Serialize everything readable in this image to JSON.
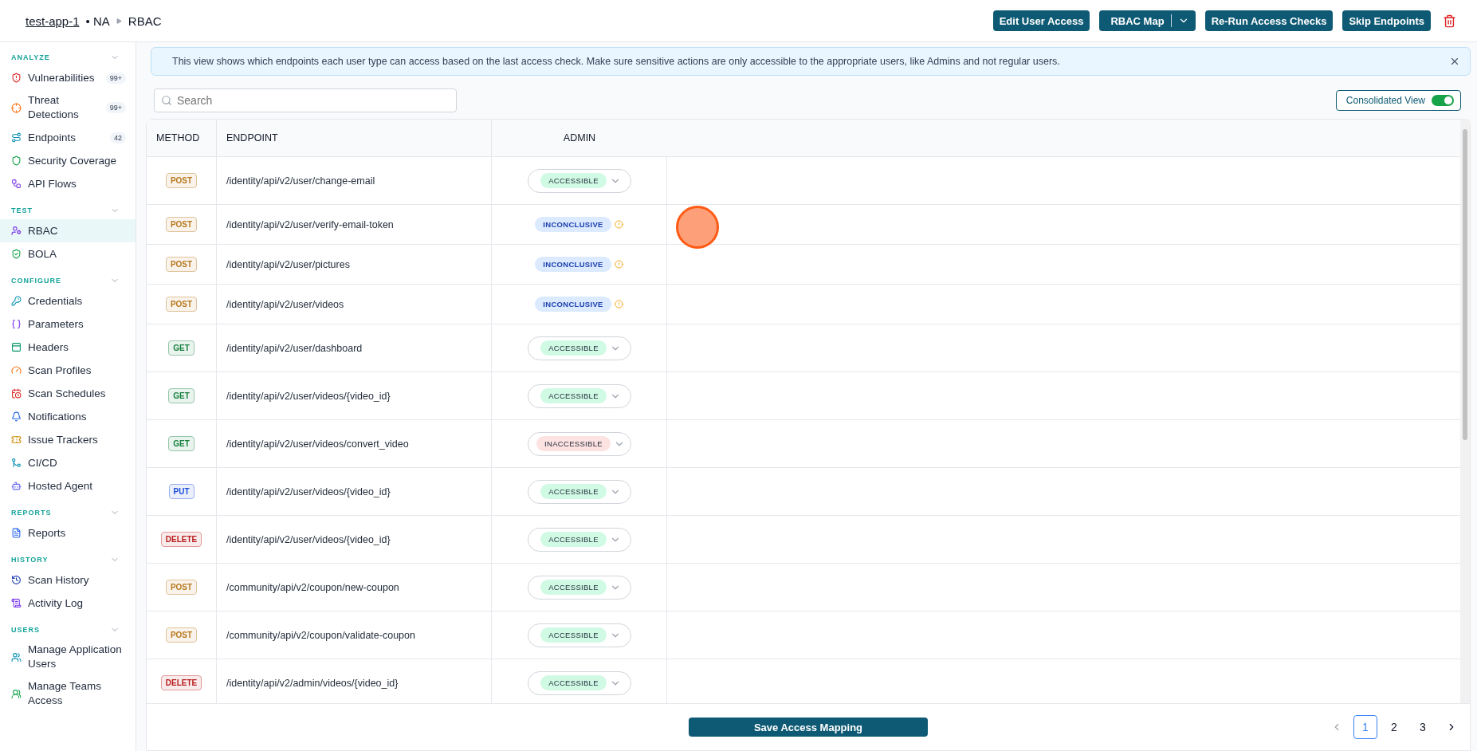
{
  "breadcrumb": {
    "app": "test-app-1",
    "env": "• NA",
    "page": "RBAC"
  },
  "actions": [
    {
      "label": "Edit User Access",
      "kind": "plain"
    },
    {
      "label": "RBAC Map",
      "kind": "split"
    },
    {
      "label": "Re-Run Access Checks",
      "kind": "plain"
    },
    {
      "label": "Skip Endpoints",
      "kind": "plain"
    }
  ],
  "sidebar": [
    {
      "title": "ANALYZE",
      "expanded": true,
      "items": [
        {
          "label": "Vulnerabilities",
          "badge": "99+",
          "selected": false
        },
        {
          "label": "Threat Detections",
          "badge": "99+",
          "selected": false
        },
        {
          "label": "Endpoints",
          "badge": "42",
          "selected": false
        },
        {
          "label": "Security Coverage",
          "selected": false
        },
        {
          "label": "API Flows",
          "selected": false
        }
      ]
    },
    {
      "title": "TEST",
      "expanded": true,
      "items": [
        {
          "label": "RBAC",
          "selected": true
        },
        {
          "label": "BOLA",
          "selected": false
        }
      ]
    },
    {
      "title": "CONFIGURE",
      "expanded": true,
      "items": [
        {
          "label": "Credentials",
          "selected": false
        },
        {
          "label": "Parameters",
          "selected": false
        },
        {
          "label": "Headers",
          "selected": false
        },
        {
          "label": "Scan Profiles",
          "selected": false
        },
        {
          "label": "Scan Schedules",
          "selected": false
        },
        {
          "label": "Notifications",
          "selected": false
        },
        {
          "label": "Issue Trackers",
          "selected": false
        },
        {
          "label": "CI/CD",
          "selected": false
        },
        {
          "label": "Hosted Agent",
          "selected": false
        }
      ]
    },
    {
      "title": "REPORTS",
      "expanded": true,
      "items": [
        {
          "label": "Reports",
          "selected": false
        }
      ]
    },
    {
      "title": "HISTORY",
      "expanded": true,
      "items": [
        {
          "label": "Scan History",
          "selected": false
        },
        {
          "label": "Activity Log",
          "selected": false
        }
      ]
    },
    {
      "title": "USERS",
      "expanded": true,
      "items": [
        {
          "label": "Manage Application Users",
          "selected": false
        },
        {
          "label": "Manage Teams Access",
          "selected": false
        }
      ]
    }
  ],
  "banner": {
    "text": "This view shows which endpoints each user type can access based on the last access check. Make sure sensitive actions are only accessible to the appropriate users, like Admins and not regular users."
  },
  "search": {
    "placeholder": "Search"
  },
  "consolidated_view": {
    "label": "Consolidated View",
    "on": true
  },
  "table": {
    "columns": [
      "METHOD",
      "ENDPOINT",
      "ADMIN"
    ],
    "rows": [
      {
        "method": {
          "label": "POST",
          "color": "#b7791f"
        },
        "endpoint": "/identity/api/v2/user/change-email",
        "admin": {
          "label": "ACCESSIBLE",
          "kind": "accessible"
        }
      },
      {
        "method": {
          "label": "POST",
          "color": "#b7791f"
        },
        "endpoint": "/identity/api/v2/user/verify-email-token",
        "admin": {
          "label": "INCONCLUSIVE",
          "kind": "inconclusive"
        }
      },
      {
        "method": {
          "label": "POST",
          "color": "#b7791f"
        },
        "endpoint": "/identity/api/v2/user/pictures",
        "admin": {
          "label": "INCONCLUSIVE",
          "kind": "inconclusive"
        }
      },
      {
        "method": {
          "label": "POST",
          "color": "#b7791f"
        },
        "endpoint": "/identity/api/v2/user/videos",
        "admin": {
          "label": "INCONCLUSIVE",
          "kind": "inconclusive"
        }
      },
      {
        "method": {
          "label": "GET",
          "color": "#15803d"
        },
        "endpoint": "/identity/api/v2/user/dashboard",
        "admin": {
          "label": "ACCESSIBLE",
          "kind": "accessible"
        }
      },
      {
        "method": {
          "label": "GET",
          "color": "#15803d"
        },
        "endpoint": "/identity/api/v2/user/videos/{video_id}",
        "admin": {
          "label": "ACCESSIBLE",
          "kind": "accessible"
        }
      },
      {
        "method": {
          "label": "GET",
          "color": "#15803d"
        },
        "endpoint": "/identity/api/v2/user/videos/convert_video",
        "admin": {
          "label": "INACCESSIBLE",
          "kind": "inaccessible"
        }
      },
      {
        "method": {
          "label": "PUT",
          "color": "#1d4ed8"
        },
        "endpoint": "/identity/api/v2/user/videos/{video_id}",
        "admin": {
          "label": "ACCESSIBLE",
          "kind": "accessible"
        }
      },
      {
        "method": {
          "label": "DELETE",
          "color": "#b91c1c"
        },
        "endpoint": "/identity/api/v2/user/videos/{video_id}",
        "admin": {
          "label": "ACCESSIBLE",
          "kind": "accessible"
        }
      },
      {
        "method": {
          "label": "POST",
          "color": "#b7791f"
        },
        "endpoint": "/community/api/v2/coupon/new-coupon",
        "admin": {
          "label": "ACCESSIBLE",
          "kind": "accessible"
        }
      },
      {
        "method": {
          "label": "POST",
          "color": "#b7791f"
        },
        "endpoint": "/community/api/v2/coupon/validate-coupon",
        "admin": {
          "label": "ACCESSIBLE",
          "kind": "accessible"
        }
      },
      {
        "method": {
          "label": "DELETE",
          "color": "#b91c1c"
        },
        "endpoint": "/identity/api/v2/admin/videos/{video_id}",
        "admin": {
          "label": "ACCESSIBLE",
          "kind": "accessible"
        }
      }
    ]
  },
  "save_button": "Save Access Mapping",
  "pagination": [
    {
      "label": "1",
      "selected": true
    },
    {
      "label": "2",
      "selected": false
    },
    {
      "label": "3",
      "selected": false
    }
  ]
}
